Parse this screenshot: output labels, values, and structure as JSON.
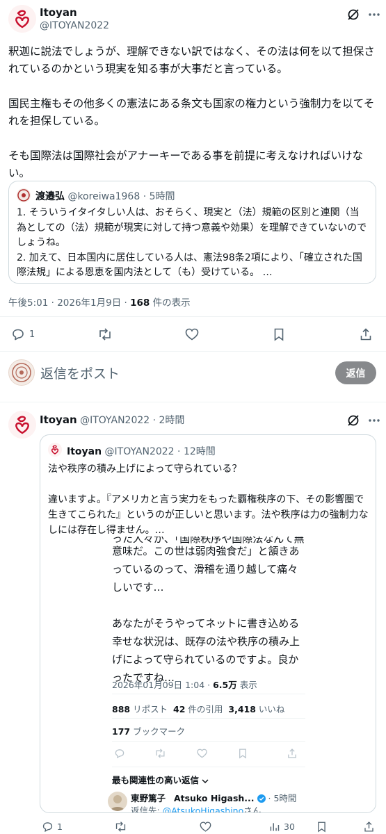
{
  "main_post": {
    "author_name": "Itoyan",
    "author_handle": "@ITOYAN2022",
    "paragraphs": [
      "釈迦に説法でしょうが、理解できない訳ではなく、その法は何を以て担保されているのかという現実を知る事が大事だと言っている。",
      "国民主権もその他多くの憲法にある条文も国家の権力という強制力を以てそれを担保している。",
      "そも国際法は国際社会がアナーキーである事を前提に考えなければいけない。"
    ],
    "quoted": {
      "author_name": "渡邉弘",
      "author_handle": "@koreiwa1968",
      "time": "· 5時間",
      "text": "1.  そういうイタイタしい人は、おそらく、現実と（法）規範の区別と連関（当為としての（法）規範が現実に対して持つ意義や効果）を理解できていないのでしょうね。\n2.  加えて、日本国内に居住している人は、憲法98条2項により、「確立された国際法規」による恩恵を国内法として（も）受けている。 …"
    },
    "timestamp": "午後5:01 · 2026年1月9日 · ",
    "views_count": "168",
    "views_label": " 件の表示",
    "reply_count": "1",
    "retweet_count": "",
    "like_count": ""
  },
  "composer": {
    "placeholder": "返信をポスト",
    "reply_button": "返信"
  },
  "reply_post": {
    "author_name": "Itoyan",
    "author_handle": "@ITOYAN2022",
    "time": "· 2時間",
    "quoted": {
      "author_name": "Itoyan",
      "author_handle": "@ITOYAN2022",
      "time": "· 12時間",
      "text1": "法や秩序の積み上げによって守られている？",
      "text2": "違いますよ。『アメリカと言う実力をもった覇権秩序の下、その影響圏で生きてこられた』というのが正しいと思います。法や秩序は力の強制力なしには存在し得ません。…",
      "screenshot": {
        "cut_line": "った人々が、「国際秩序や国際法なんて無",
        "text1": "意味だ。この世は弱肉強食だ」と頷きあっているのって、滑稽を通り越して痛々しいです…",
        "text2": "あなたがそうやってネットに書き込める幸せな状況は、既存の法や秩序の積み上げによって守られているのですよ。良かったですね…",
        "timestamp": "2026年01月09日 1:04 · ",
        "views_count": "6.5万",
        "views_label": " 表示",
        "reposts_count": "888",
        "reposts_label": " リポスト",
        "quotes_count": "42",
        "quotes_label": " 件の引用",
        "likes_count": "3,418",
        "likes_label": " いいね",
        "bookmarks_count": "177",
        "bookmarks_label": " ブックマーク",
        "sort_label": "最も関連性の高い返信",
        "reply_author_name": "東野篤子",
        "reply_author_alias": "Atsuko Higash...",
        "reply_time": "· 5時間",
        "reply_to_label": "返信先: ",
        "reply_to_handle": "@AtsukoHigashino",
        "reply_to_suffix": "さん"
      }
    },
    "reply_count": "1",
    "retweet_count": "",
    "like_count": "",
    "views_count": "30"
  },
  "colors": {
    "text": "#0f1419",
    "muted": "#536471",
    "border": "#cfd9de",
    "verified": "#1d9bf0",
    "reply_button_bg": "#87898c",
    "logo_red": "#c8102e"
  }
}
